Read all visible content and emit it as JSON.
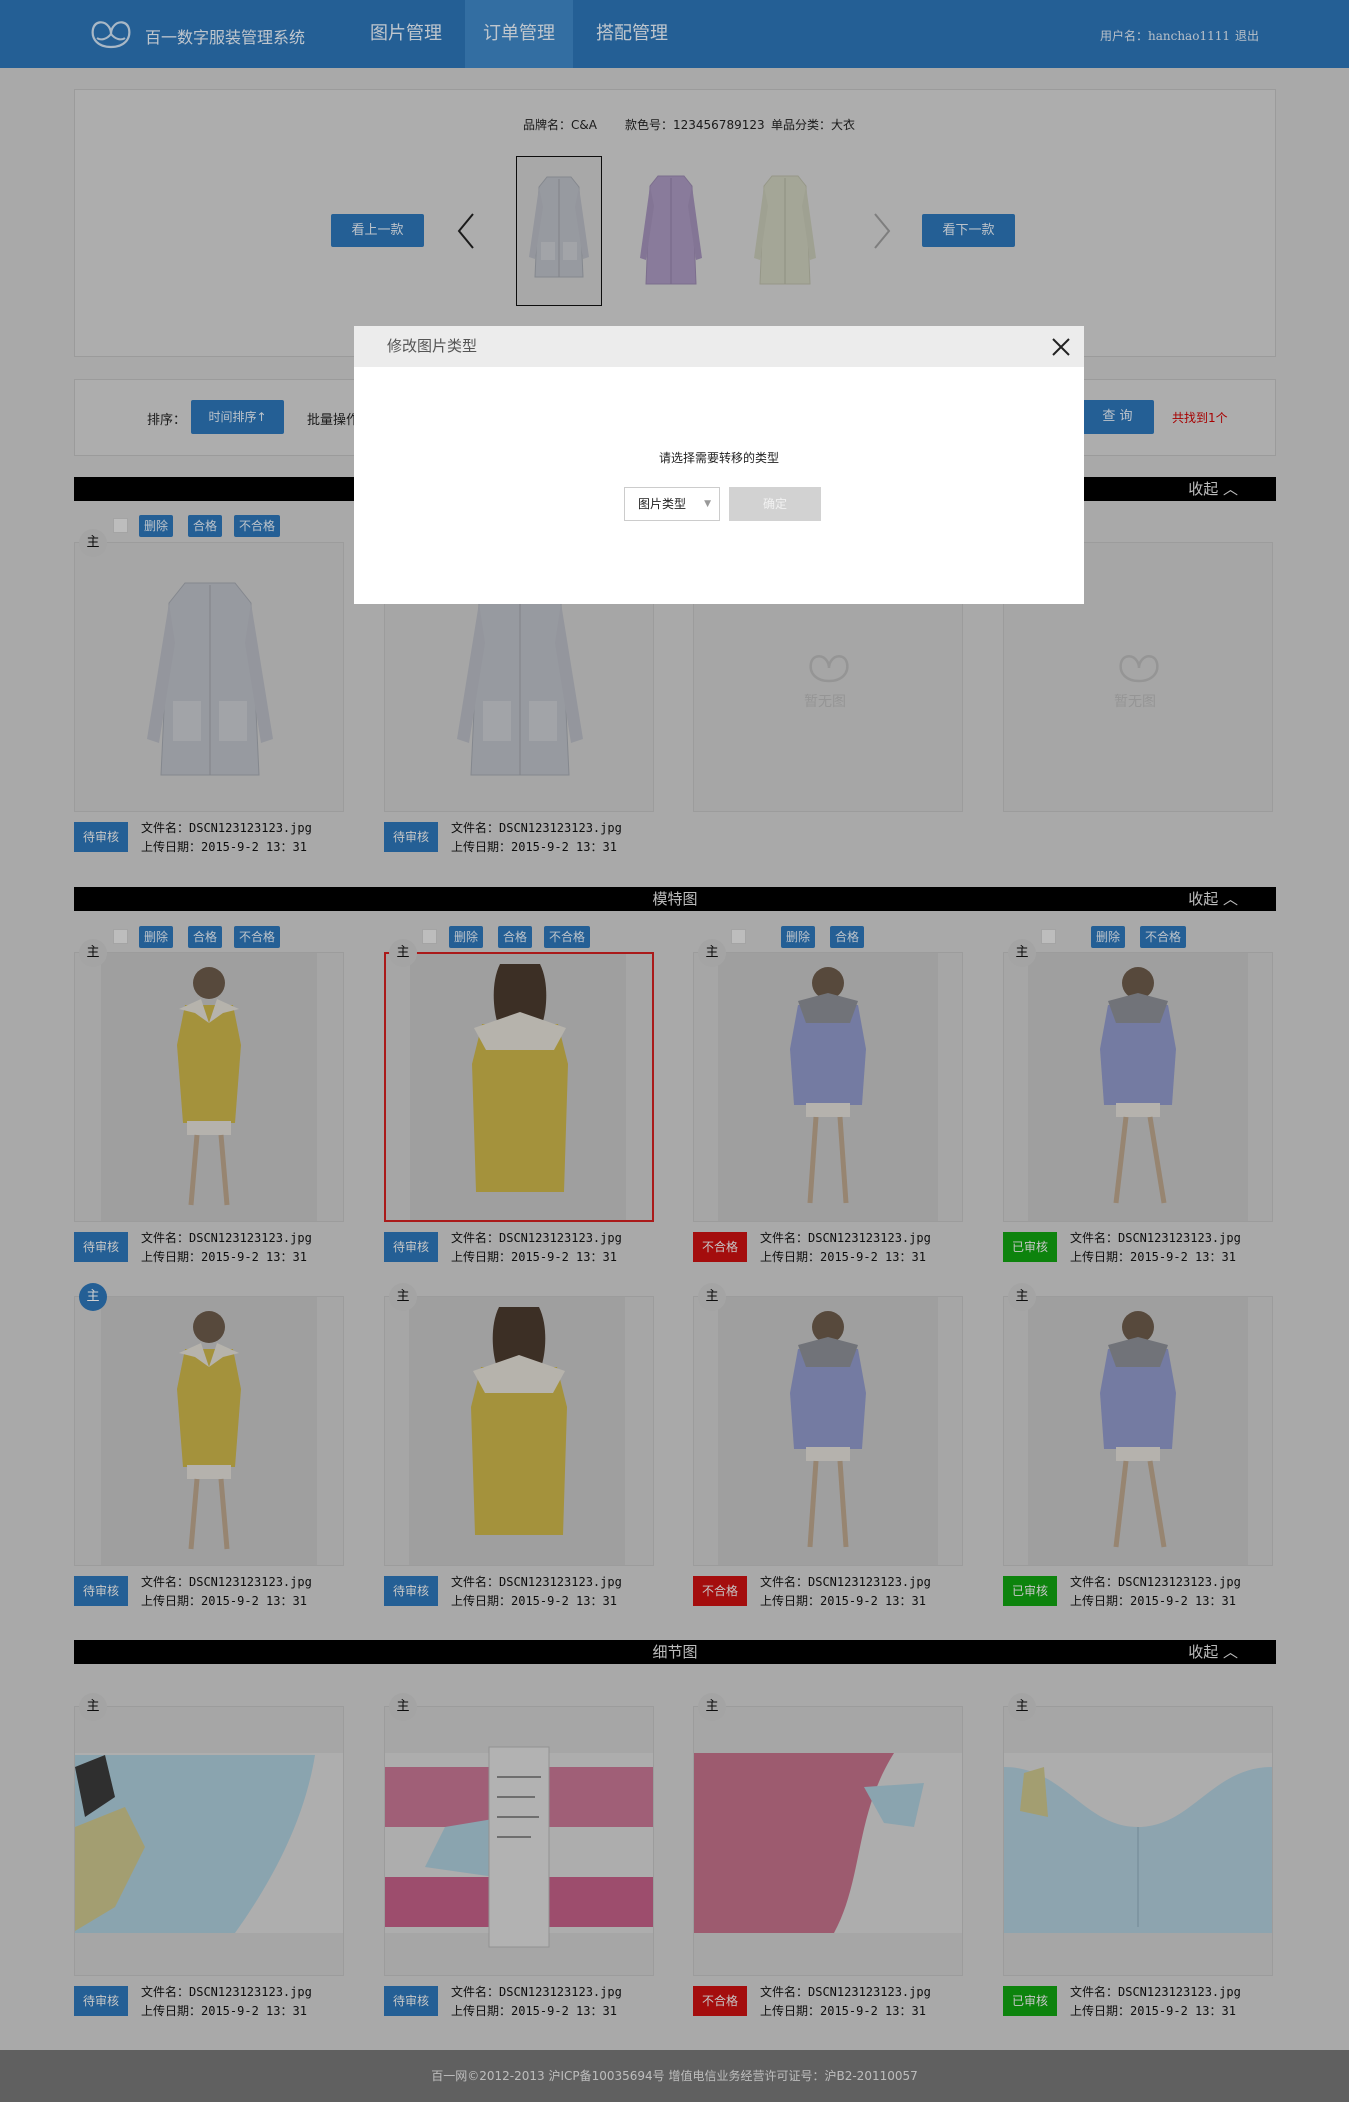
{
  "header": {
    "app_name": "百一数字服装管理系统",
    "nav": [
      {
        "label": "图片管理"
      },
      {
        "label": "订单管理"
      },
      {
        "label": "搭配管理"
      }
    ],
    "user_label": "用户名：hanchao1111",
    "logout": "退出",
    "color": "#2d75b6"
  },
  "product": {
    "brand": "品牌名：C&A",
    "style_no": "款色号：123456789123",
    "category": "单品分类：大衣",
    "prev_btn": "看上一款",
    "next_btn": "看下一款"
  },
  "toolbar": {
    "sort_label": "排序：",
    "sort_btn": "时间排序↑",
    "batch_label": "批量操作",
    "query_btn": "查 询",
    "result": "共找到1个"
  },
  "actions": {
    "delete": "删除",
    "pass": "合格",
    "fail": "不合格",
    "main": "主"
  },
  "sections": [
    {
      "title": "",
      "collapse": "收起"
    },
    {
      "title": "模特图",
      "collapse": "收起"
    },
    {
      "title": "细节图",
      "collapse": "收起"
    }
  ],
  "cards": {
    "file": "文件名：DSCN123123123.jpg",
    "date": "上传日期：2015-9-2 13：31",
    "placeholder": "暂无图"
  },
  "status": {
    "pending": "待审核",
    "fail": "不合格",
    "ok": "已审核"
  },
  "modal": {
    "title": "修改图片类型",
    "prompt": "请选择需要转移的类型",
    "select": "图片类型",
    "confirm": "确定"
  },
  "footer": "百一网©2012-2013  沪ICP备10035694号  增值电信业务经营许可证号：沪B2-20110057"
}
